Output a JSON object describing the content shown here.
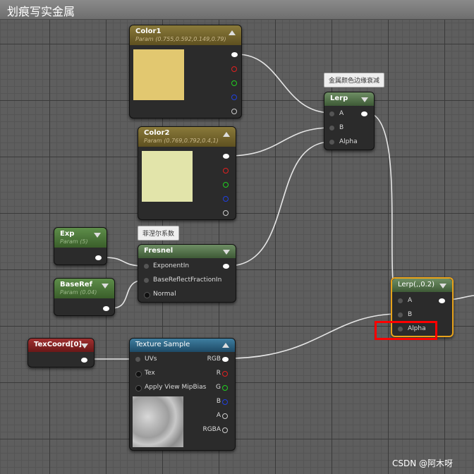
{
  "window": {
    "title": "划痕写实金属"
  },
  "comments": {
    "lerp1": "金属颜色边缘衰减",
    "fresnel": "菲涅尔系数"
  },
  "nodes": {
    "color1": {
      "title": "Color1",
      "subtitle": "Param (0.755,0.592,0.149,0.79)",
      "swatch": "#e2c870"
    },
    "color2": {
      "title": "Color2",
      "subtitle": "Param (0.769,0.792,0.4,1)",
      "swatch": "#e2e4aa"
    },
    "exp": {
      "title": "Exp",
      "subtitle": "Param (5)"
    },
    "baseref": {
      "title": "BaseRef",
      "subtitle": "Param (0.04)"
    },
    "fresnel": {
      "title": "Fresnel",
      "pins": [
        "ExponentIn",
        "BaseReflectFractionIn",
        "Normal"
      ]
    },
    "lerp1": {
      "title": "Lerp",
      "pins": [
        "A",
        "B",
        "Alpha"
      ]
    },
    "lerp2": {
      "title": "Lerp(,,0.2)",
      "pins": [
        "A",
        "B",
        "Alpha"
      ]
    },
    "texcoord": {
      "title": "TexCoord[0]"
    },
    "texture": {
      "title": "Texture Sample",
      "inputs": [
        "UVs",
        "Tex",
        "Apply View MipBias"
      ],
      "outputs": [
        "RGB",
        "R",
        "G",
        "B",
        "A",
        "RGBA"
      ]
    }
  },
  "colors": {
    "param_header": "#7a6a2e",
    "fresnel_header": "#4e6e46",
    "texcoord_header": "#8a2020",
    "texture_header": "#2e5e7e",
    "highlight": "#ff0000",
    "selected": "#e8a21a"
  },
  "watermark": "CSDN @阿木呀"
}
